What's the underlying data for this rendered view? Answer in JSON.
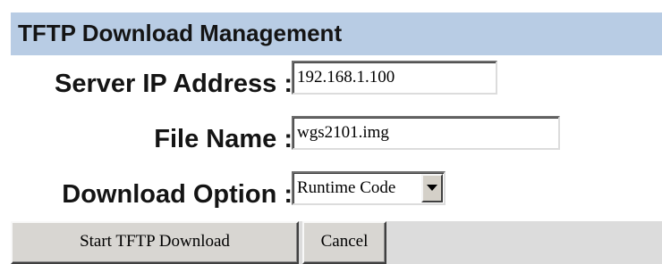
{
  "header": {
    "title": "TFTP Download Management",
    "color": "#b8cce4"
  },
  "form": {
    "server_ip_label": "Server IP Address :",
    "server_ip_value": "192.168.1.100",
    "file_name_label": "File Name :",
    "file_name_value": "wgs2101.img",
    "download_option_label": "Download Option :",
    "download_option_value": "Runtime Code",
    "dropdown_icon": "chevron-down-icon"
  },
  "buttons": {
    "start_label": "Start TFTP Download",
    "cancel_label": "Cancel"
  }
}
